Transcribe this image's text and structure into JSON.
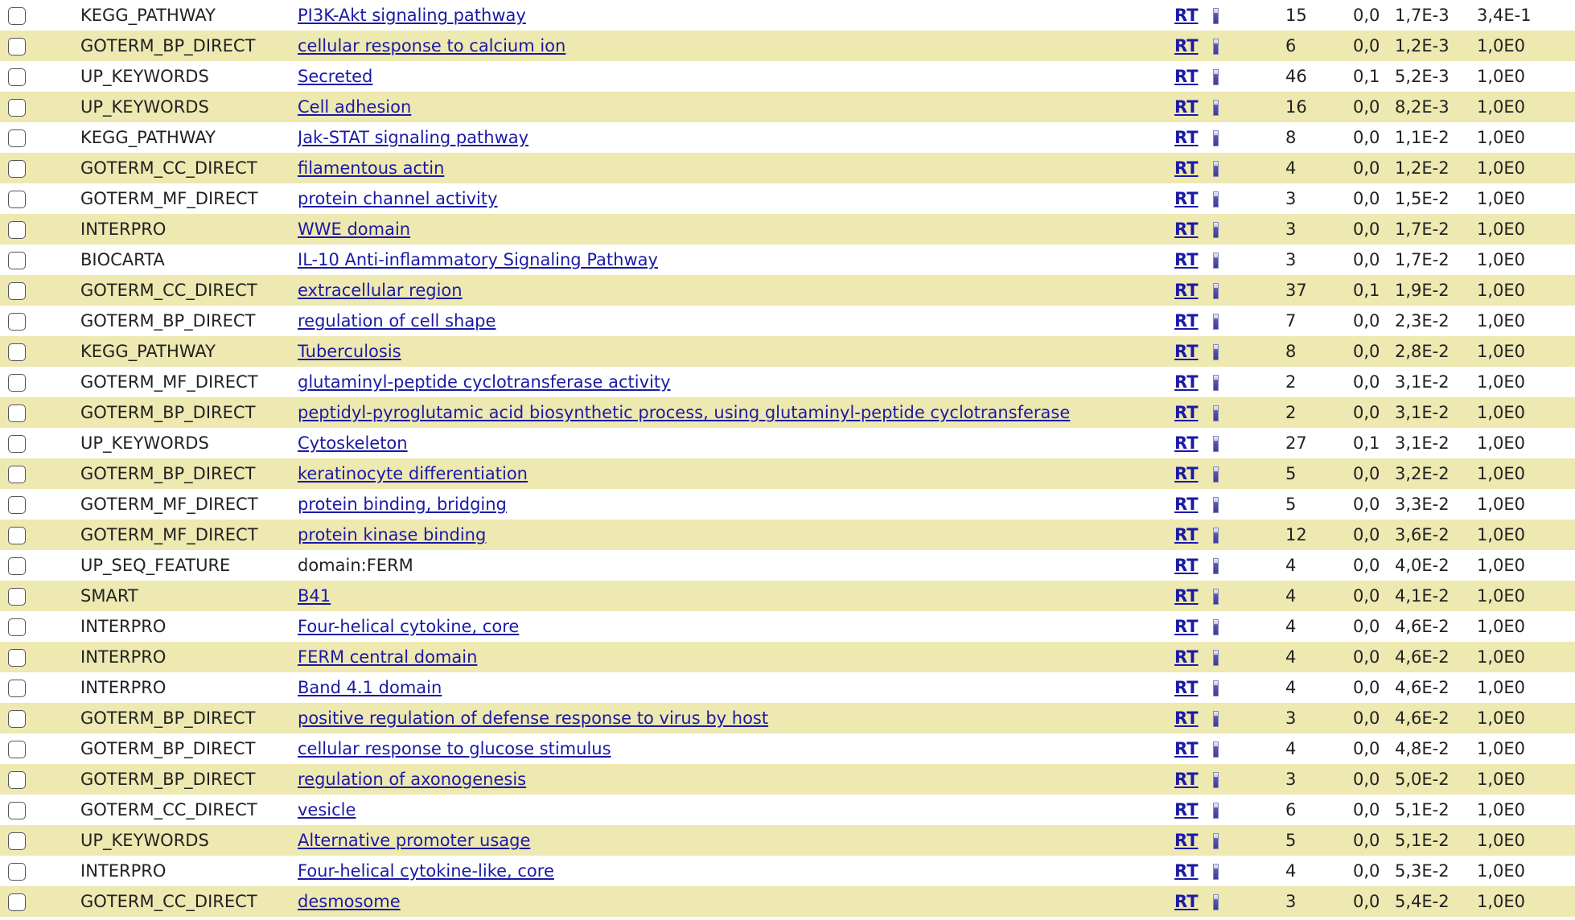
{
  "colors": {
    "row_even": "#eee8b1",
    "row_odd": "#ffffff",
    "link": "#1a1aa6"
  },
  "icons": {
    "checkbox": "checkbox-icon",
    "bar": "bar-chart-icon"
  },
  "rows": [
    {
      "category": "KEGG_PATHWAY",
      "term": "PI3K-Akt signaling pathway",
      "link": true,
      "rt": "RT",
      "count": "15",
      "pct": "0,0",
      "pvalue": "1,7E-3",
      "benjamini": "3,4E-1"
    },
    {
      "category": "GOTERM_BP_DIRECT",
      "term": "cellular response to calcium ion",
      "link": true,
      "rt": "RT",
      "count": "6",
      "pct": "0,0",
      "pvalue": "1,2E-3",
      "benjamini": "1,0E0"
    },
    {
      "category": "UP_KEYWORDS",
      "term": "Secreted",
      "link": true,
      "rt": "RT",
      "count": "46",
      "pct": "0,1",
      "pvalue": "5,2E-3",
      "benjamini": "1,0E0"
    },
    {
      "category": "UP_KEYWORDS",
      "term": "Cell adhesion",
      "link": true,
      "rt": "RT",
      "count": "16",
      "pct": "0,0",
      "pvalue": "8,2E-3",
      "benjamini": "1,0E0"
    },
    {
      "category": "KEGG_PATHWAY",
      "term": "Jak-STAT signaling pathway",
      "link": true,
      "rt": "RT",
      "count": "8",
      "pct": "0,0",
      "pvalue": "1,1E-2",
      "benjamini": "1,0E0"
    },
    {
      "category": "GOTERM_CC_DIRECT",
      "term": "filamentous actin",
      "link": true,
      "rt": "RT",
      "count": "4",
      "pct": "0,0",
      "pvalue": "1,2E-2",
      "benjamini": "1,0E0"
    },
    {
      "category": "GOTERM_MF_DIRECT",
      "term": "protein channel activity",
      "link": true,
      "rt": "RT",
      "count": "3",
      "pct": "0,0",
      "pvalue": "1,5E-2",
      "benjamini": "1,0E0"
    },
    {
      "category": "INTERPRO",
      "term": "WWE domain",
      "link": true,
      "rt": "RT",
      "count": "3",
      "pct": "0,0",
      "pvalue": "1,7E-2",
      "benjamini": "1,0E0"
    },
    {
      "category": "BIOCARTA",
      "term": "IL-10 Anti-inflammatory Signaling Pathway",
      "link": true,
      "rt": "RT",
      "count": "3",
      "pct": "0,0",
      "pvalue": "1,7E-2",
      "benjamini": "1,0E0"
    },
    {
      "category": "GOTERM_CC_DIRECT",
      "term": "extracellular region",
      "link": true,
      "rt": "RT",
      "count": "37",
      "pct": "0,1",
      "pvalue": "1,9E-2",
      "benjamini": "1,0E0"
    },
    {
      "category": "GOTERM_BP_DIRECT",
      "term": "regulation of cell shape",
      "link": true,
      "rt": "RT",
      "count": "7",
      "pct": "0,0",
      "pvalue": "2,3E-2",
      "benjamini": "1,0E0"
    },
    {
      "category": "KEGG_PATHWAY",
      "term": "Tuberculosis",
      "link": true,
      "rt": "RT",
      "count": "8",
      "pct": "0,0",
      "pvalue": "2,8E-2",
      "benjamini": "1,0E0"
    },
    {
      "category": "GOTERM_MF_DIRECT",
      "term": "glutaminyl-peptide cyclotransferase activity",
      "link": true,
      "rt": "RT",
      "count": "2",
      "pct": "0,0",
      "pvalue": "3,1E-2",
      "benjamini": "1,0E0"
    },
    {
      "category": "GOTERM_BP_DIRECT",
      "term": "peptidyl-pyroglutamic acid biosynthetic process, using glutaminyl-peptide cyclotransferase",
      "link": true,
      "rt": "RT",
      "count": "2",
      "pct": "0,0",
      "pvalue": "3,1E-2",
      "benjamini": "1,0E0"
    },
    {
      "category": "UP_KEYWORDS",
      "term": "Cytoskeleton",
      "link": true,
      "rt": "RT",
      "count": "27",
      "pct": "0,1",
      "pvalue": "3,1E-2",
      "benjamini": "1,0E0"
    },
    {
      "category": "GOTERM_BP_DIRECT",
      "term": "keratinocyte differentiation",
      "link": true,
      "rt": "RT",
      "count": "5",
      "pct": "0,0",
      "pvalue": "3,2E-2",
      "benjamini": "1,0E0"
    },
    {
      "category": "GOTERM_MF_DIRECT",
      "term": "protein binding, bridging",
      "link": true,
      "rt": "RT",
      "count": "5",
      "pct": "0,0",
      "pvalue": "3,3E-2",
      "benjamini": "1,0E0"
    },
    {
      "category": "GOTERM_MF_DIRECT",
      "term": "protein kinase binding",
      "link": true,
      "rt": "RT",
      "count": "12",
      "pct": "0,0",
      "pvalue": "3,6E-2",
      "benjamini": "1,0E0"
    },
    {
      "category": "UP_SEQ_FEATURE",
      "term": "domain:FERM",
      "link": false,
      "rt": "RT",
      "count": "4",
      "pct": "0,0",
      "pvalue": "4,0E-2",
      "benjamini": "1,0E0"
    },
    {
      "category": "SMART",
      "term": "B41",
      "link": true,
      "rt": "RT",
      "count": "4",
      "pct": "0,0",
      "pvalue": "4,1E-2",
      "benjamini": "1,0E0"
    },
    {
      "category": "INTERPRO",
      "term": "Four-helical cytokine, core",
      "link": true,
      "rt": "RT",
      "count": "4",
      "pct": "0,0",
      "pvalue": "4,6E-2",
      "benjamini": "1,0E0"
    },
    {
      "category": "INTERPRO",
      "term": "FERM central domain",
      "link": true,
      "rt": "RT",
      "count": "4",
      "pct": "0,0",
      "pvalue": "4,6E-2",
      "benjamini": "1,0E0"
    },
    {
      "category": "INTERPRO",
      "term": "Band 4.1 domain",
      "link": true,
      "rt": "RT",
      "count": "4",
      "pct": "0,0",
      "pvalue": "4,6E-2",
      "benjamini": "1,0E0"
    },
    {
      "category": "GOTERM_BP_DIRECT",
      "term": "positive regulation of defense response to virus by host",
      "link": true,
      "rt": "RT",
      "count": "3",
      "pct": "0,0",
      "pvalue": "4,6E-2",
      "benjamini": "1,0E0"
    },
    {
      "category": "GOTERM_BP_DIRECT",
      "term": "cellular response to glucose stimulus",
      "link": true,
      "rt": "RT",
      "count": "4",
      "pct": "0,0",
      "pvalue": "4,8E-2",
      "benjamini": "1,0E0"
    },
    {
      "category": "GOTERM_BP_DIRECT",
      "term": "regulation of axonogenesis",
      "link": true,
      "rt": "RT",
      "count": "3",
      "pct": "0,0",
      "pvalue": "5,0E-2",
      "benjamini": "1,0E0"
    },
    {
      "category": "GOTERM_CC_DIRECT",
      "term": "vesicle",
      "link": true,
      "rt": "RT",
      "count": "6",
      "pct": "0,0",
      "pvalue": "5,1E-2",
      "benjamini": "1,0E0"
    },
    {
      "category": "UP_KEYWORDS",
      "term": "Alternative promoter usage",
      "link": true,
      "rt": "RT",
      "count": "5",
      "pct": "0,0",
      "pvalue": "5,1E-2",
      "benjamini": "1,0E0"
    },
    {
      "category": "INTERPRO",
      "term": "Four-helical cytokine-like, core",
      "link": true,
      "rt": "RT",
      "count": "4",
      "pct": "0,0",
      "pvalue": "5,3E-2",
      "benjamini": "1,0E0"
    },
    {
      "category": "GOTERM_CC_DIRECT",
      "term": "desmosome",
      "link": true,
      "rt": "RT",
      "count": "3",
      "pct": "0,0",
      "pvalue": "5,4E-2",
      "benjamini": "1,0E0"
    }
  ]
}
